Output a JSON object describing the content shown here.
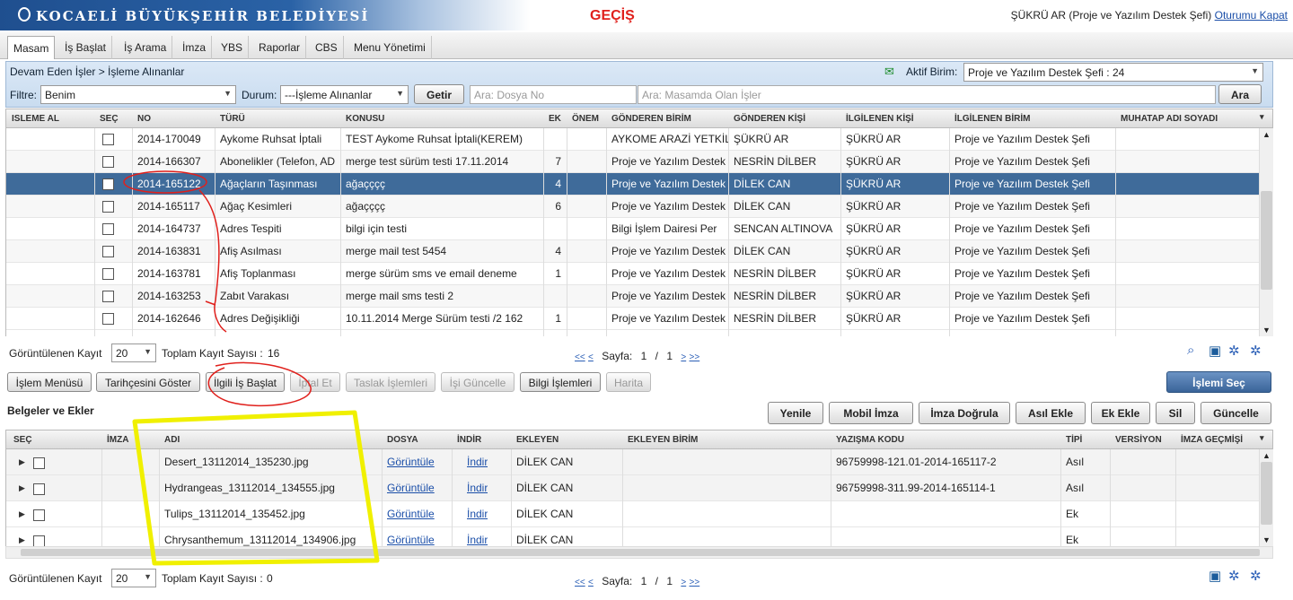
{
  "header": {
    "logo_text": "KOCAELİ BÜYÜKŞEHİR BELEDİYESİ",
    "annotation": "GEÇİŞ",
    "user": "ŞÜKRÜ AR (Proje ve Yazılım Destek Şefi)",
    "logout": "Oturumu Kapat"
  },
  "menu": [
    "Masam",
    "İş Başlat",
    "İş Arama",
    "İmza",
    "YBS",
    "Raporlar",
    "CBS",
    "Menu Yönetimi"
  ],
  "panel": {
    "breadcrumb": "Devam Eden İşler > İşleme Alınanlar",
    "active_unit_label": "Aktif Birim:",
    "active_unit": "Proje ve Yazılım Destek Şefi : 24",
    "filter_label": "Filtre:",
    "filter_value": "Benim",
    "status_label": "Durum:",
    "status_value": "---İşleme Alınanlar",
    "go": "Getir",
    "search_file_ph": "Ara: Dosya No",
    "search_desk_ph": "Ara: Masamda Olan İşler",
    "search": "Ara"
  },
  "grid1": {
    "columns": [
      "ISLEME AL",
      "SEÇ",
      "NO",
      "TÜRÜ",
      "KONUSU",
      "EK",
      "ÖNEM",
      "GÖNDEREN BİRİM",
      "GÖNDEREN KİŞİ",
      "İLGİLENEN KİŞİ",
      "İLGİLENEN BİRİM",
      "MUHATAP ADI SOYADI"
    ],
    "rows": [
      [
        "2014-170049",
        "Aykome Ruhsat İptali",
        "TEST Aykome Ruhsat İptali(KEREM)",
        "",
        "AYKOME ARAZİ YETKİLİ",
        "ŞÜKRÜ AR",
        "ŞÜKRÜ AR",
        "Proje ve Yazılım Destek Şefi"
      ],
      [
        "2014-166307",
        "Abonelikler (Telefon, AD",
        "merge test sürüm testi 17.11.2014",
        "7",
        "Proje ve Yazılım Destek",
        "NESRİN DİLBER",
        "ŞÜKRÜ AR",
        "Proje ve Yazılım Destek Şefi"
      ],
      [
        "2014-165122",
        "Ağaçların Taşınması",
        "ağaçççç",
        "4",
        "Proje ve Yazılım Destek",
        "DİLEK CAN",
        "ŞÜKRÜ AR",
        "Proje ve Yazılım Destek Şefi"
      ],
      [
        "2014-165117",
        "Ağaç Kesimleri",
        "ağaçççç",
        "6",
        "Proje ve Yazılım Destek",
        "DİLEK CAN",
        "ŞÜKRÜ AR",
        "Proje ve Yazılım Destek Şefi"
      ],
      [
        "2014-164737",
        "Adres Tespiti",
        "bilgi için testi",
        "",
        "Bilgi İşlem Dairesi Per",
        "SENCAN ALTINOVA",
        "ŞÜKRÜ AR",
        "Proje ve Yazılım Destek Şefi"
      ],
      [
        "2014-163831",
        "Afiş Asılması",
        "merge mail test 5454",
        "4",
        "Proje ve Yazılım Destek",
        "DİLEK CAN",
        "ŞÜKRÜ AR",
        "Proje ve Yazılım Destek Şefi"
      ],
      [
        "2014-163781",
        "Afiş Toplanması",
        "merge sürüm sms ve email deneme",
        "1",
        "Proje ve Yazılım Destek",
        "NESRİN DİLBER",
        "ŞÜKRÜ AR",
        "Proje ve Yazılım Destek Şefi"
      ],
      [
        "2014-163253",
        "Zabıt Varakası",
        "merge mail sms testi 2",
        "",
        "Proje ve Yazılım Destek",
        "NESRİN DİLBER",
        "ŞÜKRÜ AR",
        "Proje ve Yazılım Destek Şefi"
      ],
      [
        "2014-162646",
        "Adres Değişikliği",
        "10.11.2014 Merge Sürüm testi /2 162",
        "1",
        "Proje ve Yazılım Destek",
        "NESRİN DİLBER",
        "ŞÜKRÜ AR",
        "Proje ve Yazılım Destek Şefi"
      ]
    ]
  },
  "pager1": {
    "shown_label": "Görüntülenen Kayıt",
    "shown": "20",
    "total_label": "Toplam Kayıt Sayısı :",
    "total": "16",
    "page_label": "Sayfa:",
    "page": "1",
    "sep": "/",
    "pages": "1"
  },
  "actions": [
    "İşlem Menüsü",
    "Tarihçesini Göster",
    "İlgili İş Başlat",
    "İptal Et",
    "Taslak İşlemleri",
    "İşi Güncelle",
    "Bilgi İşlemleri",
    "Harita"
  ],
  "select_btn": "İşlemi Seç",
  "docs": {
    "title": "Belgeler ve Ekler",
    "buttons": [
      "Yenile",
      "Mobil İmza",
      "İmza Doğrula",
      "Asıl Ekle",
      "Ek Ekle",
      "Sil",
      "Güncelle"
    ],
    "columns": [
      "SEÇ",
      "İMZA",
      "ADI",
      "DOSYA",
      "İNDİR",
      "EKLEYEN",
      "EKLEYEN BİRİM",
      "YAZIŞMA KODU",
      "TİPİ",
      "VERSİYON",
      "İMZA GEÇMİŞİ"
    ],
    "rows": [
      [
        "Desert_13112014_135230.jpg",
        "Görüntüle",
        "İndir",
        "DİLEK CAN",
        "96759998-121.01-2014-165117-2",
        "Asıl"
      ],
      [
        "Hydrangeas_13112014_134555.jpg",
        "Görüntüle",
        "İndir",
        "DİLEK CAN",
        "96759998-311.99-2014-165114-1",
        "Asıl"
      ],
      [
        "Tulips_13112014_135452.jpg",
        "Görüntüle",
        "İndir",
        "DİLEK CAN",
        "",
        "Ek"
      ],
      [
        "Chrysanthemum_13112014_134906.jpg",
        "Görüntüle",
        "İndir",
        "DİLEK CAN",
        "",
        "Ek"
      ]
    ]
  },
  "pager2": {
    "shown_label": "Görüntülenen Kayıt",
    "shown": "20",
    "total_label": "Toplam Kayıt Sayısı :",
    "total": "0",
    "page_label": "Sayfa:",
    "page": "1",
    "sep": "/",
    "pages": "1"
  }
}
